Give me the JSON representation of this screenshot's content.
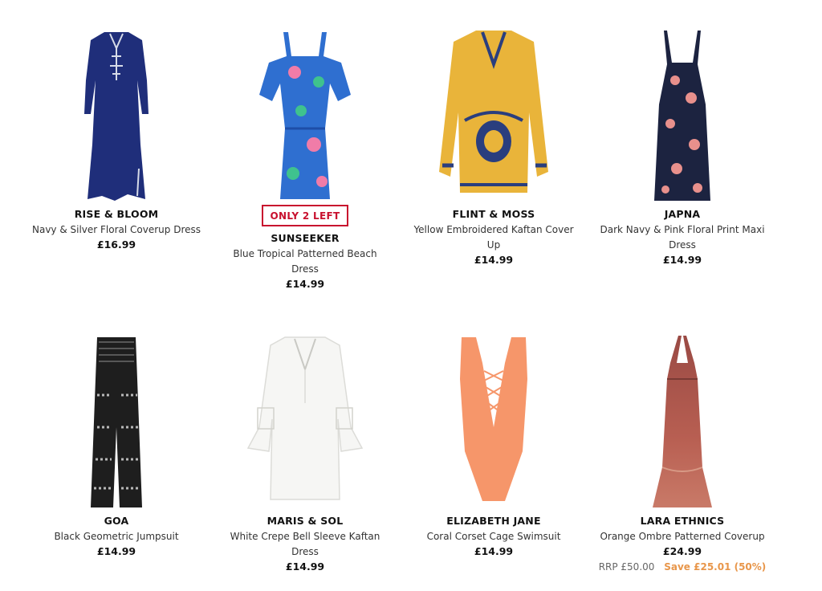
{
  "products": [
    {
      "brand": "RISE & BLOOM",
      "title": "Navy & Silver Floral Coverup Dress",
      "price": "£16.99",
      "image": "navy-kaftan-dress-image",
      "colors": {
        "main": "#1f2e7a",
        "accent": "#d6dbe8"
      }
    },
    {
      "brand": "SUNSEEKER",
      "badge": "ONLY 2 LEFT",
      "title": "Blue Tropical Patterned Beach Dress",
      "price": "£14.99",
      "image": "blue-tropical-playsuit-image",
      "colors": {
        "main": "#2f6fd0",
        "accent": "#f07ca8"
      }
    },
    {
      "brand": "FLINT & MOSS",
      "title": "Yellow Embroidered Kaftan Cover Up",
      "price": "£14.99",
      "image": "yellow-kaftan-image",
      "colors": {
        "main": "#e9b43a",
        "accent": "#2a3e7e"
      }
    },
    {
      "brand": "JAPNA",
      "title": "Dark Navy & Pink Floral Print Maxi Dress",
      "price": "£14.99",
      "image": "navy-floral-maxi-image",
      "colors": {
        "main": "#1c2340",
        "accent": "#e8908c"
      }
    },
    {
      "brand": "GOA",
      "title": "Black Geometric Jumpsuit",
      "price": "£14.99",
      "image": "black-geometric-jumpsuit-image",
      "colors": {
        "main": "#1e1e1e",
        "accent": "#b8b8b8"
      }
    },
    {
      "brand": "MARIS & SOL",
      "title": "White Crepe Bell Sleeve Kaftan Dress",
      "price": "£14.99",
      "image": "white-kaftan-image",
      "colors": {
        "main": "#f6f6f4",
        "accent": "#dcdcd8"
      }
    },
    {
      "brand": "ELIZABETH JANE",
      "title": "Coral Corset Cage Swimsuit",
      "price": "£14.99",
      "image": "coral-swimsuit-image",
      "colors": {
        "main": "#f6966a",
        "accent": "#ffffff"
      }
    },
    {
      "brand": "LARA ETHNICS",
      "title": "Orange Ombre Patterned Coverup",
      "price": "£24.99",
      "rrp": "RRP £50.00",
      "save": "Save £25.01 (50%)",
      "image": "ombre-halter-dress-image",
      "colors": {
        "main": "#b85f52",
        "accent": "#d89a86"
      }
    }
  ]
}
